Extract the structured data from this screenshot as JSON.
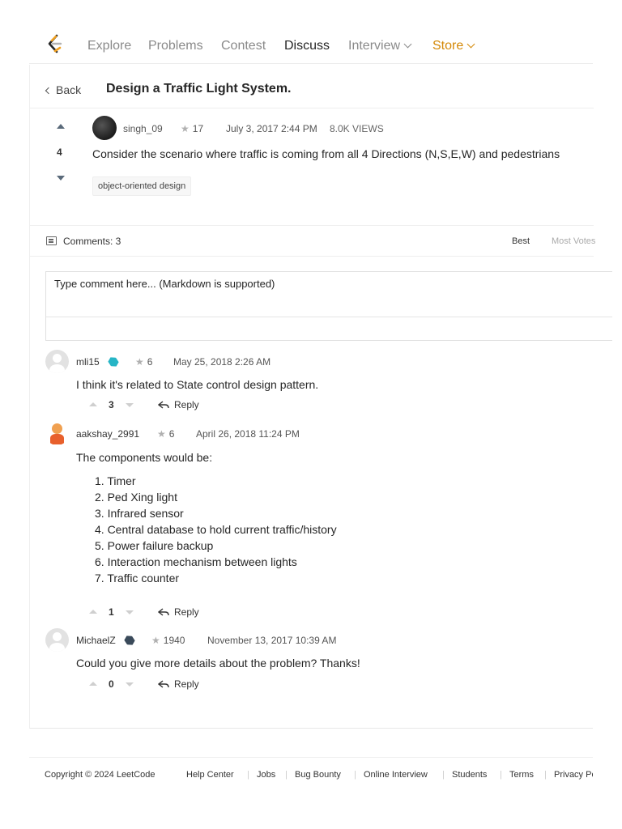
{
  "nav": {
    "items": [
      "Explore",
      "Problems",
      "Contest",
      "Discuss",
      "Interview",
      "Store"
    ],
    "active": "Discuss",
    "colors": {
      "store": "#d48806",
      "logo_orange": "#f0a020",
      "logo_dark": "#262626"
    }
  },
  "post": {
    "back_label": "Back",
    "title": "Design a Traffic Light System.",
    "votes": "4",
    "author": "singh_09",
    "reputation": "17",
    "date": "July 3, 2017 2:44 PM",
    "views": "8.0K VIEWS",
    "body": "Consider the scenario where traffic is coming from all 4 Directions (N,S,E,W) and pedestrians",
    "tag": "object-oriented design"
  },
  "comments_bar": {
    "label": "Comments: 3",
    "sort_best": "Best",
    "sort_most": "Most Votes"
  },
  "comment_box": {
    "placeholder": "Type comment here... (Markdown is supported)"
  },
  "comments": [
    {
      "user": "mli15",
      "reputation": "6",
      "date": "May 25, 2018 2:26 AM",
      "text": "I think it's related to State control design pattern.",
      "votes": "3",
      "reply_label": "Reply",
      "badge_color": "#26b5c6"
    },
    {
      "user": "aakshay_2991",
      "reputation": "6",
      "date": "April 26, 2018 11:24 PM",
      "text": "The components would be:",
      "list": [
        "1. Timer",
        "2. Ped Xing light",
        "3. Infrared sensor",
        "4. Central database to hold current traffic/history",
        "5. Power failure backup",
        "6. Interaction mechanism between lights",
        "7. Traffic counter"
      ],
      "votes": "1",
      "reply_label": "Reply"
    },
    {
      "user": "MichaelZ",
      "reputation": "1940",
      "date": "November 13, 2017 10:39 AM",
      "text": "Could you give more details about the problem? Thanks!",
      "votes": "0",
      "reply_label": "Reply",
      "badge_color": "#3a4a5a"
    }
  ],
  "footer": {
    "copyright": "Copyright © 2024 LeetCode",
    "links": [
      "Help Center",
      "Jobs",
      "Bug Bounty",
      "Online Interview",
      "Students",
      "Terms",
      "Privacy Policy"
    ]
  }
}
